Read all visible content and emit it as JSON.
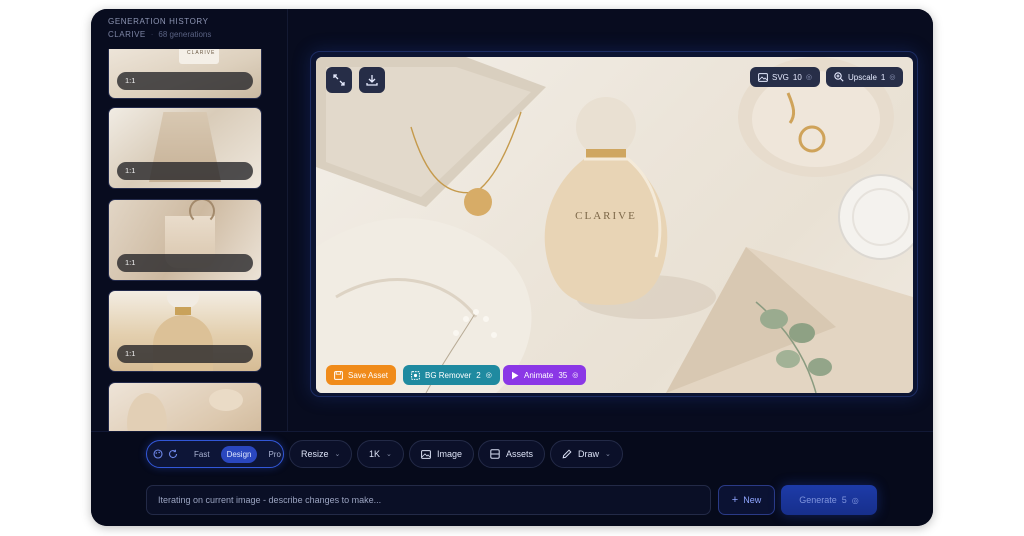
{
  "sidebar": {
    "title": "GENERATION HISTORY",
    "brand": "CLARIVE",
    "separator": "·",
    "count": "68 generations",
    "thumbnails": [
      {
        "ratio": "1:1"
      },
      {
        "ratio": "1:1"
      },
      {
        "ratio": "1:1"
      },
      {
        "ratio": "1:1"
      }
    ]
  },
  "preview": {
    "product_label": "CLARIVE",
    "top_right": {
      "svg_label": "SVG",
      "svg_cost": "10",
      "upscale_label": "Upscale",
      "upscale_cost": "1"
    },
    "actions": {
      "save_label": "Save Asset",
      "bg_label": "BG Remover",
      "bg_cost": "2",
      "animate_label": "Animate",
      "animate_cost": "35"
    }
  },
  "toolbar": {
    "modes": [
      "Fast",
      "Design",
      "Pro"
    ],
    "active_mode": "Design",
    "resize_label": "Resize",
    "resolution_label": "1K",
    "image_label": "Image",
    "assets_label": "Assets",
    "draw_label": "Draw"
  },
  "composer": {
    "placeholder": "Iterating on current image - describe changes to make...",
    "new_label": "New",
    "generate_label": "Generate",
    "generate_cost": "5"
  },
  "colors": {
    "background": "#070b1d",
    "accent": "#2a47bf",
    "save": "#f08b1a",
    "bg_remover": "#1f8aa0",
    "animate": "#8b37e6"
  }
}
